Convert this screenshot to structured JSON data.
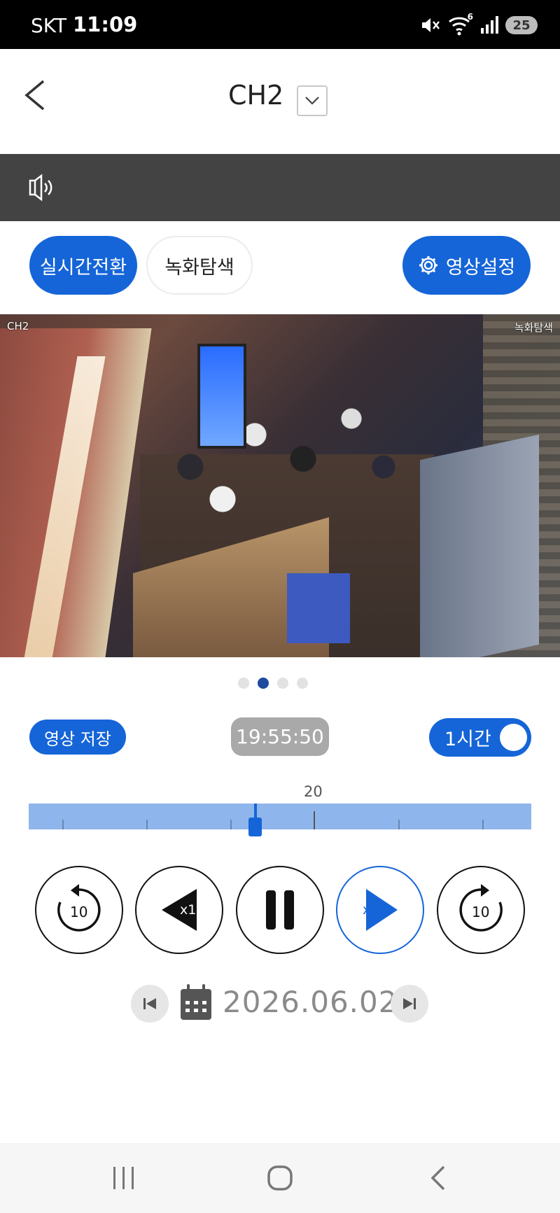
{
  "status_bar": {
    "carrier": "SKT",
    "time": "11:09",
    "battery": "25",
    "wifi_badge": "6"
  },
  "header": {
    "channel": "CH2"
  },
  "modes": {
    "live": "실시간전환",
    "record": "녹화탐색",
    "settings": "영상설정"
  },
  "video": {
    "channel_label": "CH2",
    "mode_label": "녹화탐색"
  },
  "pager": {
    "count": 4,
    "active_index": 1
  },
  "playback": {
    "save_label": "영상 저장",
    "current_time": "19:55:50",
    "range_label": "1시간",
    "range_toggle_on": true
  },
  "timeline": {
    "hour_label": "20",
    "position_fraction": 0.451
  },
  "controls": {
    "rewind_label": "10",
    "reverse_speed": "x1",
    "forward_speed": "x1",
    "forward_label": "10"
  },
  "date": {
    "value": "2026.06.02"
  },
  "colors": {
    "accent": "#1565d8",
    "dark_bar": "#434343",
    "timeline": "#8fb6ec",
    "badge_gray": "#a9a9a9"
  }
}
